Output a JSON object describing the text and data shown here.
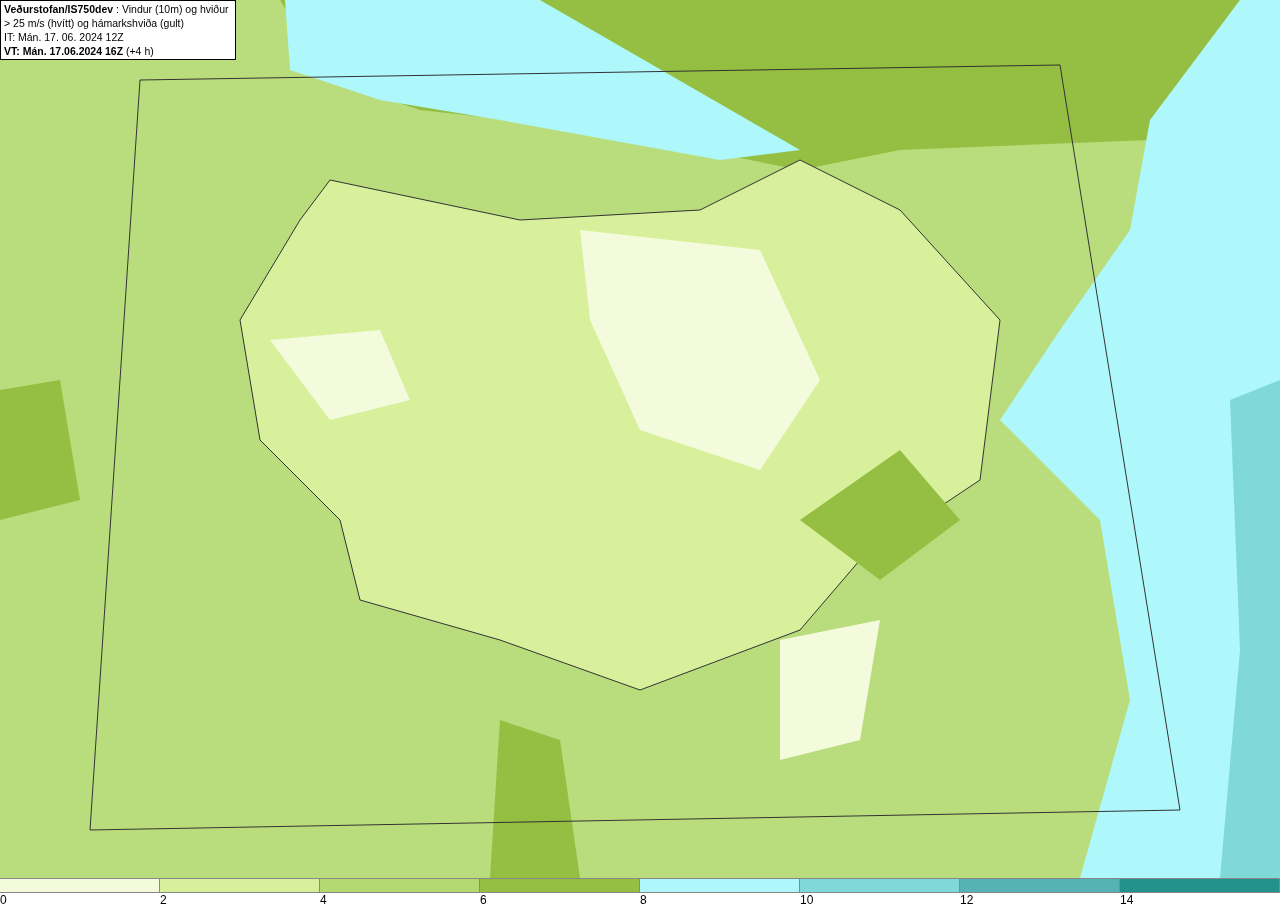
{
  "title_box": {
    "heading": "**Veðurstofan/IS750dev** : Vindur (10m) og hviður > 25 m/s (hvítt) og hámarkshviða (gult)",
    "issue_time": "IT: Mán. 17. 06. 2024 12Z",
    "valid_time": "**VT: Mán. 17.06.2024 16Z** (+4 h)"
  },
  "legend": {
    "segments": [
      {
        "color": "#f4fadc"
      },
      {
        "color": "#d8ef9c"
      },
      {
        "color": "#b5d972"
      },
      {
        "color": "#94bf42"
      },
      {
        "color": "#aef8fb"
      },
      {
        "color": "#80d8d8"
      },
      {
        "color": "#55b3b5"
      },
      {
        "color": "#23918c"
      }
    ],
    "ticks": [
      "0",
      "2",
      "4",
      "6",
      "8",
      "10",
      "12",
      "14"
    ]
  }
}
